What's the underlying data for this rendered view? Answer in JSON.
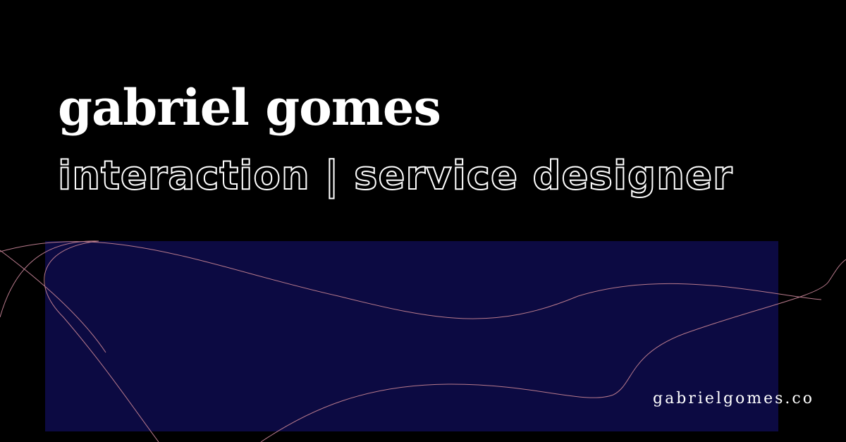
{
  "header": {
    "name": "gabriel gomes",
    "role": "interaction | service designer"
  },
  "footer": {
    "url": "gabrielgomes.co"
  },
  "colors": {
    "background": "#000000",
    "panel": "#0c0a42",
    "text": "#ffffff",
    "curve": "#b87a8c"
  }
}
